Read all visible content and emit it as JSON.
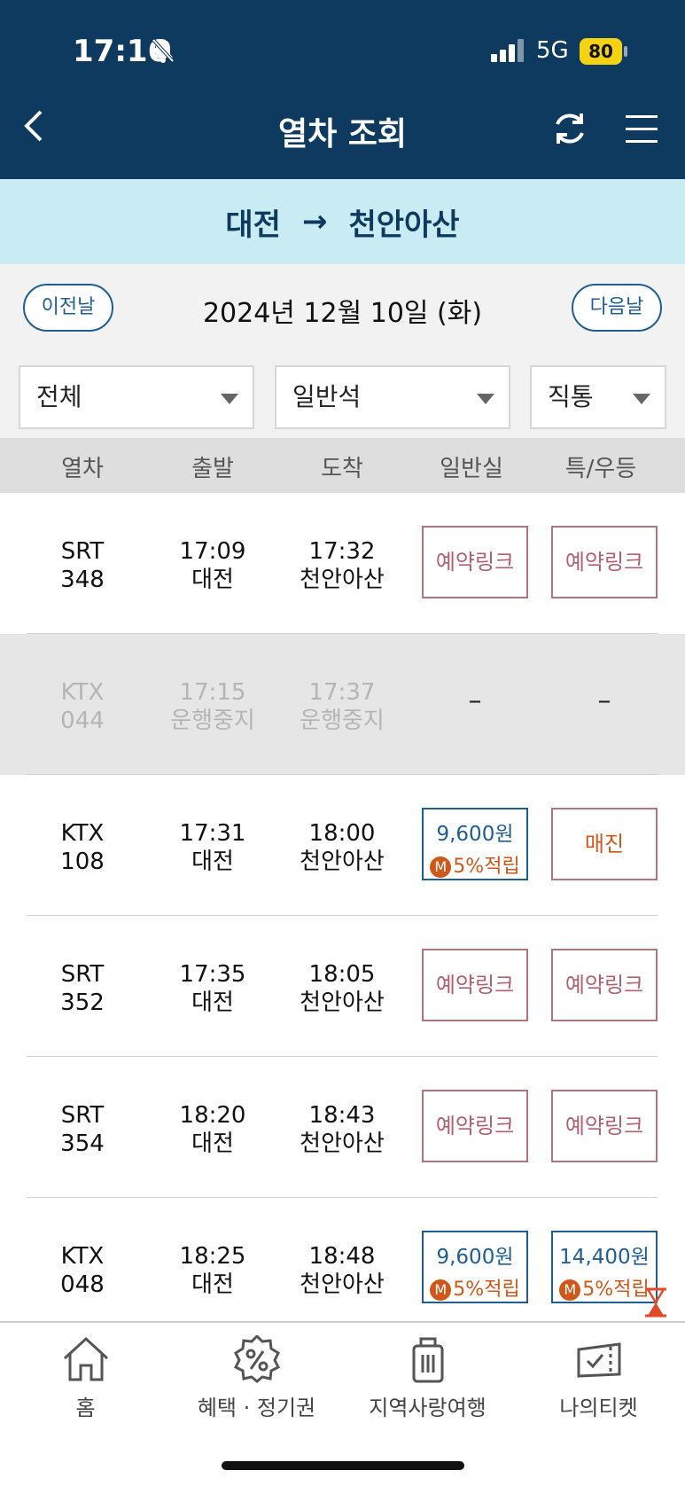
{
  "status": {
    "time": "17:16",
    "network": "5G",
    "battery": "80"
  },
  "header": {
    "title": "열차 조회"
  },
  "route": {
    "from": "대전",
    "arrow": "→",
    "to": "천안아산"
  },
  "datebar": {
    "prev": "이전날",
    "date": "2024년 12월 10일 (화)",
    "next": "다음날"
  },
  "filters": {
    "train_type": "전체",
    "seat_class": "일반석",
    "route_type": "직통"
  },
  "columns": [
    "열차",
    "출발",
    "도착",
    "일반실",
    "특/우등"
  ],
  "trains": [
    {
      "train": "SRT",
      "number": "348",
      "dep_time": "17:09",
      "dep_station": "대전",
      "arr_time": "17:32",
      "arr_station": "천안아산",
      "general": "예약링크",
      "special": "예약링크"
    },
    {
      "train": "KTX",
      "number": "044",
      "dep_time": "17:15",
      "dep_station": "운행중지",
      "arr_time": "17:37",
      "arr_station": "운행중지",
      "general": "–",
      "special": "–"
    },
    {
      "train": "KTX",
      "number": "108",
      "dep_time": "17:31",
      "dep_station": "대전",
      "arr_time": "18:00",
      "arr_station": "천안아산",
      "general_price": "9,600원",
      "general_points": "5%적립",
      "special": "매진"
    },
    {
      "train": "SRT",
      "number": "352",
      "dep_time": "17:35",
      "dep_station": "대전",
      "arr_time": "18:05",
      "arr_station": "천안아산",
      "general": "예약링크",
      "special": "예약링크"
    },
    {
      "train": "SRT",
      "number": "354",
      "dep_time": "18:20",
      "dep_station": "대전",
      "arr_time": "18:43",
      "arr_station": "천안아산",
      "general": "예약링크",
      "special": "예약링크"
    },
    {
      "train": "KTX",
      "number": "048",
      "dep_time": "18:25",
      "dep_station": "대전",
      "arr_time": "18:48",
      "arr_station": "천안아산",
      "general_price": "9,600원",
      "general_points": "5%적립",
      "special_price": "14,400원",
      "special_points": "5%적립"
    }
  ],
  "mileage_badge": "M",
  "nav": {
    "home": "홈",
    "benefits": "혜택 · 정기권",
    "travel": "지역사랑여행",
    "tickets": "나의티켓"
  },
  "colors": {
    "header_bg": "#0e3a5f",
    "route_bg": "#c9ecf4",
    "link_border": "#b07680",
    "price_blue": "#1f5d92",
    "points_orange": "#d0571a"
  }
}
